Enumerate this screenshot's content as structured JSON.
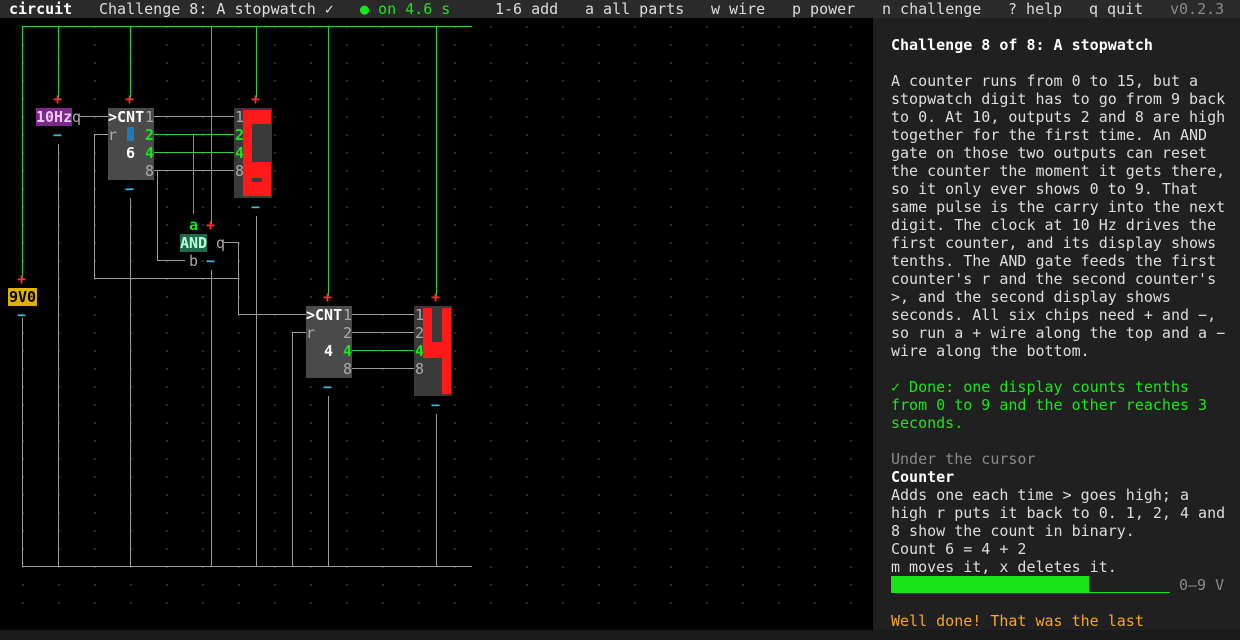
{
  "topbar": {
    "app": "circuit",
    "challenge": "Challenge 8: A stopwatch ✓",
    "status": "● on 4.6 s",
    "menu": [
      "1-6 add",
      "a all parts",
      "w wire",
      "p power",
      "n challenge",
      "? help",
      "q quit"
    ],
    "version": "v0.2.3"
  },
  "circuit": {
    "clock_label": "10Hz",
    "clock_out": "q",
    "battery_label": "9V0",
    "counter_label": ">CNT",
    "counter1_value": "6",
    "counter2_value": "4",
    "reset_pin": "r",
    "pins": [
      "1",
      "2",
      "4",
      "8"
    ],
    "and_label": "AND",
    "and_in_a": "a",
    "and_in_b": "b",
    "and_out": "q",
    "plus": "+",
    "minus": "−",
    "display1_digit": "6",
    "display2_digit": "4"
  },
  "panel": {
    "title": "Challenge 8 of 8: A stopwatch",
    "description": [
      "A counter runs from 0 to 15, but a",
      "stopwatch digit has to go from 9 back",
      "to 0. At 10, outputs 2 and 8 are high",
      "together for the first time. An AND",
      "gate on those two outputs can reset",
      "the counter the moment it gets there,",
      "so it only ever shows 0 to 9. That",
      "same pulse is the carry into the next",
      "digit. The clock at 10 Hz drives the",
      "first counter, and its display shows",
      "tenths. The AND gate feeds the first",
      "counter's r and the second counter's",
      ">, and the second display shows",
      "seconds. All six chips need + and −,",
      "so run a + wire along the top and a −",
      "wire along the bottom."
    ],
    "done": [
      "✓ Done: one display counts tenths",
      "from 0 to 9 and the other reaches 3",
      "seconds."
    ],
    "cursor_heading": "Under the cursor",
    "cursor_part": "Counter",
    "cursor_desc": [
      "Adds one each time > goes high; a",
      "high r puts it back to 0. 1, 2, 4 and",
      "8 show the count in binary.",
      "Count 6 = 4 + 2",
      "m moves it, x deletes it."
    ],
    "voltage_fraction": 0.71,
    "voltage_range": "0–9 V",
    "footer": "Well done! That was the last"
  },
  "colors": {
    "wire_power": "#2ecc40",
    "wire_ground": "#9a9a9a",
    "segment_on": "#ff1a1a",
    "plus": "#ff3030",
    "minus": "#3fb6d8",
    "done_text": "#19e619",
    "footer_text": "#f5a623"
  }
}
